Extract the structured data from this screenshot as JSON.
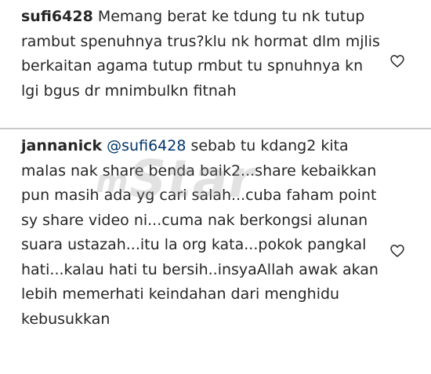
{
  "comments": [
    {
      "username": "sufi6428",
      "text": "Memang berat ke tdung tu nk tutup rambut spenuhnya trus?klu nk hormat dlm mjlis berkaitan agama tutup rmbut tu spnuhnya kn lgi bgus dr mnimbulkn fitnah",
      "icon": "heart-outline-icon"
    },
    {
      "username": "jannanick",
      "mention": "@sufi6428",
      "text": "sebab tu kdang2 kita malas nak share benda baik2...share kebaikkan pun masih ada yg cari salah...cuba faham point sy share video ni...cuma nak berkongsi alunan suara ustazah...itu la org kata...pokok pangkal hati...kalau hati tu bersih..insyaAllah awak akan lebih memerhati keindahan dari menghidu kebusukkan",
      "icon": "heart-outline-icon"
    }
  ],
  "watermark": {
    "prefix": "m",
    "main": "Star"
  },
  "colors": {
    "text": "#262626",
    "mention": "#003569",
    "divider": "#c9c9c9"
  }
}
